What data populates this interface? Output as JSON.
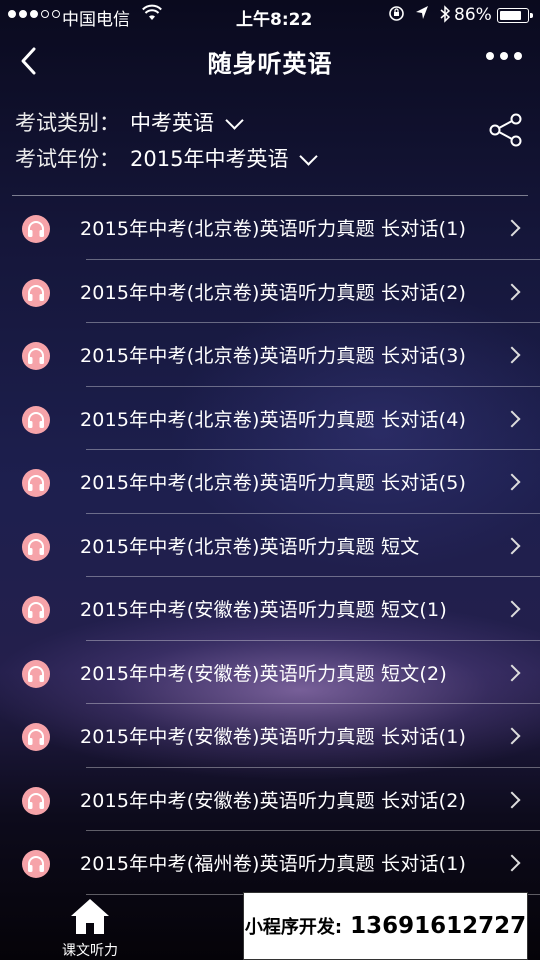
{
  "status_bar": {
    "carrier": "中国电信",
    "time": "上午8:22",
    "battery": "86%",
    "battery_level": 0.86
  },
  "nav": {
    "title": "随身听英语"
  },
  "filters": {
    "category_label": "考试类别：",
    "category_value": "中考英语",
    "year_label": "考试年份：",
    "year_value": "2015年中考英语"
  },
  "items": [
    {
      "title": "2015年中考(北京卷)英语听力真题 长对话(1)"
    },
    {
      "title": "2015年中考(北京卷)英语听力真题 长对话(2)"
    },
    {
      "title": "2015年中考(北京卷)英语听力真题 长对话(3)"
    },
    {
      "title": "2015年中考(北京卷)英语听力真题 长对话(4)"
    },
    {
      "title": "2015年中考(北京卷)英语听力真题 长对话(5)"
    },
    {
      "title": "2015年中考(北京卷)英语听力真题 短文"
    },
    {
      "title": "2015年中考(安徽卷)英语听力真题 短文(1)"
    },
    {
      "title": "2015年中考(安徽卷)英语听力真题 短文(2)"
    },
    {
      "title": "2015年中考(安徽卷)英语听力真题 长对话(1)"
    },
    {
      "title": "2015年中考(安徽卷)英语听力真题 长对话(2)"
    },
    {
      "title": "2015年中考(福州卷)英语听力真题 长对话(1)"
    }
  ],
  "tabbar": {
    "home_label": "课文听力",
    "icon": "home-icon"
  },
  "promo": {
    "label": "小程序开发:",
    "phone": "13691612727"
  },
  "colors": {
    "icon_bg": "#f6a3a9"
  }
}
